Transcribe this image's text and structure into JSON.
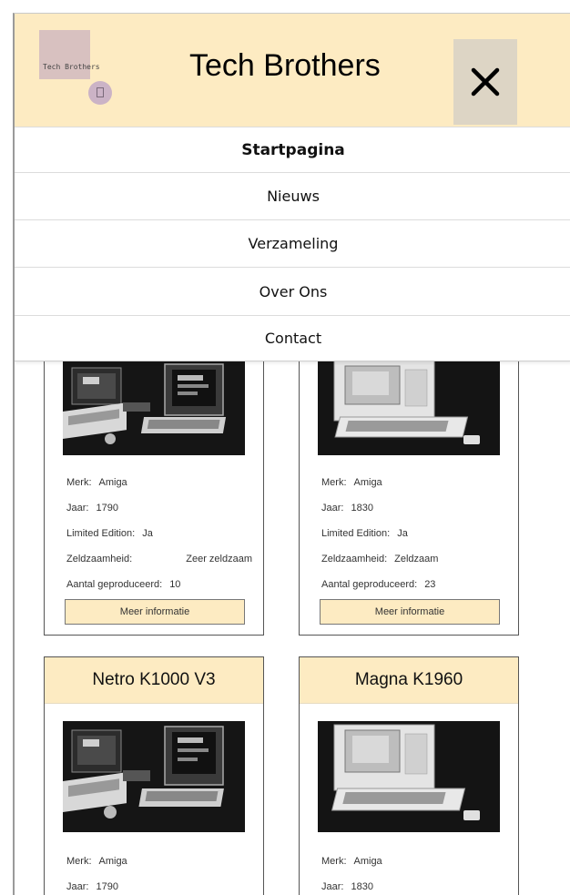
{
  "header": {
    "logo_text": "Tech Brothers",
    "title": "Tech Brothers",
    "close_glyph": "×"
  },
  "menu": {
    "items": [
      {
        "label": "Startpagina",
        "active": true
      },
      {
        "label": "Nieuws",
        "active": false
      },
      {
        "label": "Verzameling",
        "active": false
      },
      {
        "label": "Over Ons",
        "active": false
      },
      {
        "label": "Contact",
        "active": false
      }
    ]
  },
  "cards": [
    {
      "title": "",
      "image": "retro-computer-photo",
      "specs": {
        "merk_label": "Merk:",
        "merk": "Amiga",
        "jaar_label": "Jaar:",
        "jaar": "1790",
        "limited_label": "Limited Edition:",
        "limited": "Ja",
        "zeld_label": "Zeldzaamheid:",
        "zeld": "Zeer zeldzaam",
        "aantal_label": "Aantal geproduceerd:",
        "aantal": "10"
      },
      "button": "Meer informatie"
    },
    {
      "title": "",
      "image": "desktop-computer-photo",
      "specs": {
        "merk_label": "Merk:",
        "merk": "Amiga",
        "jaar_label": "Jaar:",
        "jaar": "1830",
        "limited_label": "Limited Edition:",
        "limited": "Ja",
        "zeld_label": "Zeldzaamheid:",
        "zeld": "Zeldzaam",
        "aantal_label": "Aantal geproduceerd:",
        "aantal": "23"
      },
      "button": "Meer informatie"
    },
    {
      "title": "Netro K1000 V3",
      "image": "retro-computer-photo",
      "specs": {
        "merk_label": "Merk:",
        "merk": "Amiga",
        "jaar_label": "Jaar:",
        "jaar": "1790"
      }
    },
    {
      "title": "Magna K1960",
      "image": "desktop-computer-photo",
      "specs": {
        "merk_label": "Merk:",
        "merk": "Amiga",
        "jaar_label": "Jaar:",
        "jaar": "1830"
      }
    }
  ],
  "colors": {
    "header_bg": "#fdebc2",
    "close_bg": "#ddd5c5",
    "logo_box": "#d8c1c0",
    "card_border": "#555555"
  }
}
